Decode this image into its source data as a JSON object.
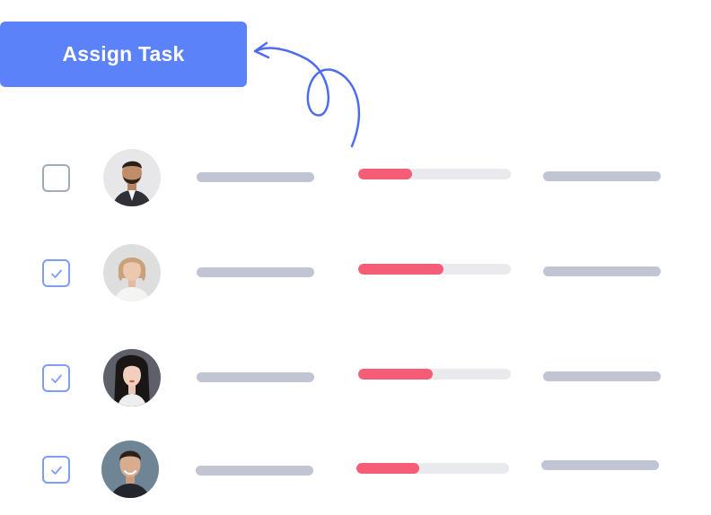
{
  "assign_button": {
    "label": "Assign Task"
  },
  "colors": {
    "button_background": "#5b82f9",
    "button_text": "#ffffff",
    "arrow_stroke": "#4e6cf0",
    "checkbox_unchecked_border": "#a3aab8",
    "checkbox_checked_border": "#7f9cf6",
    "placeholder_bar": "#c0c4d3",
    "progress_track": "#e8eaee",
    "progress_fill": "#f55d77"
  },
  "rows": [
    {
      "checked": false,
      "avatar": "avatar-man-beard-suit",
      "progress": 0.35
    },
    {
      "checked": true,
      "avatar": "avatar-woman-blonde",
      "progress": 0.56
    },
    {
      "checked": true,
      "avatar": "avatar-woman-dark-hair",
      "progress": 0.49
    },
    {
      "checked": true,
      "avatar": "avatar-man-smiling",
      "progress": 0.41
    }
  ]
}
